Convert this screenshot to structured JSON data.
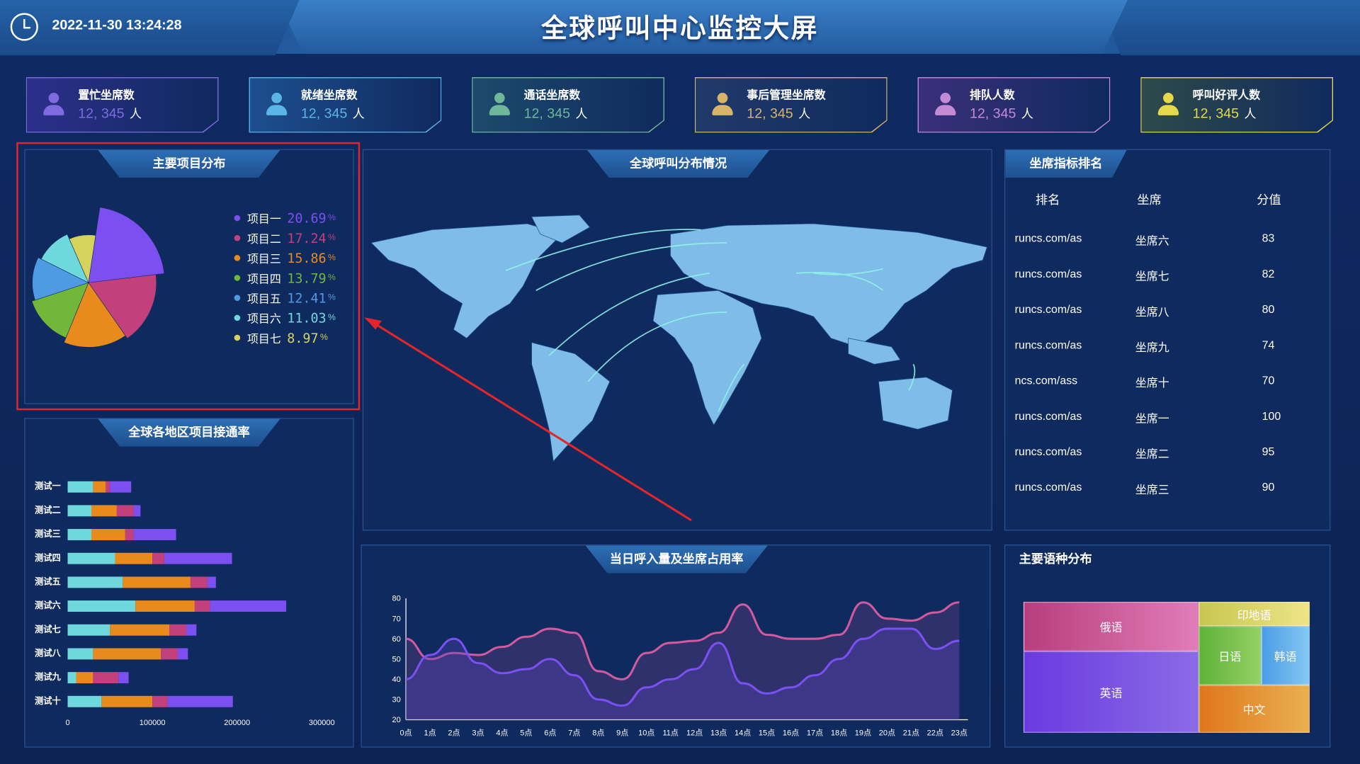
{
  "header": {
    "datetime": "2022-11-30 13:24:28",
    "title": "全球呼叫中心监控大屏"
  },
  "stats": [
    {
      "label": "置忙坐席数",
      "value": "12, 345",
      "unit": "人",
      "color": "#7e6be0",
      "bg": "#2c2f8a"
    },
    {
      "label": "就绪坐席数",
      "value": "12, 345",
      "unit": "人",
      "color": "#5bb5e6",
      "bg": "#1d4f8f"
    },
    {
      "label": "通话坐席数",
      "value": "12, 345",
      "unit": "人",
      "color": "#6fb69b",
      "bg": "#1c4a6c"
    },
    {
      "label": "事后管理坐席数",
      "value": "12, 345",
      "unit": "人",
      "color": "#d6b46a",
      "bg": "#203a6a"
    },
    {
      "label": "排队人数",
      "value": "12, 345",
      "unit": "人",
      "color": "#c48ad6",
      "bg": "#3a2f7a"
    },
    {
      "label": "呼叫好评人数",
      "value": "12, 345",
      "unit": "人",
      "color": "#e3d94a",
      "bg": "#2e4a4a"
    }
  ],
  "panels": {
    "pie": {
      "title": "主要项目分布",
      "items": [
        {
          "name": "项目一",
          "pct": "20.69",
          "sign": "%",
          "color": "#7b4ff0"
        },
        {
          "name": "项目二",
          "pct": "17.24",
          "sign": "%",
          "color": "#c2417d"
        },
        {
          "name": "项目三",
          "pct": "15.86",
          "sign": "%",
          "color": "#e98a1d"
        },
        {
          "name": "项目四",
          "pct": "13.79",
          "sign": "%",
          "color": "#72b63a"
        },
        {
          "name": "项目五",
          "pct": "12.41",
          "sign": "%",
          "color": "#4f9be3"
        },
        {
          "name": "项目六",
          "pct": "11.03",
          "sign": "%",
          "color": "#6fd8dc"
        },
        {
          "name": "项目七",
          "pct": "8.97",
          "sign": "%",
          "color": "#d6d35c"
        }
      ]
    },
    "map": {
      "title": "全球呼叫分布情况"
    },
    "rank": {
      "title": "坐席指标排名",
      "headers": [
        "排名",
        "坐席",
        "分值"
      ],
      "rows": [
        [
          "runcs.com/as",
          "坐席六",
          "83"
        ],
        [
          "runcs.com/as",
          "坐席七",
          "82"
        ],
        [
          "runcs.com/as",
          "坐席八",
          "80"
        ],
        [
          "runcs.com/as",
          "坐席九",
          "74"
        ],
        [
          "ncs.com/ass",
          "坐席十",
          "70"
        ],
        [
          "runcs.com/as",
          "坐席一",
          "100"
        ],
        [
          "runcs.com/as",
          "坐席二",
          "95"
        ],
        [
          "runcs.com/as",
          "坐席三",
          "90"
        ]
      ]
    },
    "bar": {
      "title": "全球各地区项目接通率"
    },
    "line": {
      "title": "当日呼入量及坐席占用率"
    },
    "tree": {
      "title": "主要语种分布",
      "items": [
        "俄语",
        "英语",
        "印地语",
        "日语",
        "韩语",
        "中文"
      ]
    }
  },
  "chart_data": [
    {
      "type": "pie",
      "categories": [
        "项目一",
        "项目二",
        "项目三",
        "项目四",
        "项目五",
        "项目六",
        "项目七"
      ],
      "values": [
        20.69,
        17.24,
        15.86,
        13.79,
        12.41,
        11.03,
        8.97
      ]
    },
    {
      "type": "bar",
      "categories": [
        "测试一",
        "测试二",
        "测试三",
        "测试四",
        "测试五",
        "测试六",
        "测试七",
        "测试八",
        "测试九",
        "测试十"
      ],
      "series": [
        {
          "values": [
            30000,
            28000,
            28000,
            56000,
            65000,
            80000,
            50000,
            30000,
            10000,
            40000
          ]
        },
        {
          "values": [
            15000,
            30000,
            40000,
            44000,
            80000,
            70000,
            70000,
            80000,
            20000,
            60000
          ]
        },
        {
          "values": [
            5000,
            20000,
            10000,
            14000,
            20000,
            18000,
            20000,
            20000,
            30000,
            18000
          ]
        },
        {
          "values": [
            25000,
            8000,
            50000,
            80000,
            10000,
            90000,
            12000,
            12000,
            12000,
            77000
          ]
        }
      ],
      "xlim": [
        0,
        300000
      ],
      "xticks": [
        "0",
        "100000",
        "200000",
        "300000"
      ]
    },
    {
      "type": "line",
      "x": [
        "0点",
        "1点",
        "2点",
        "3点",
        "4点",
        "5点",
        "6点",
        "7点",
        "8点",
        "9点",
        "10点",
        "11点",
        "12点",
        "13点",
        "14点",
        "15点",
        "16点",
        "17点",
        "18点",
        "19点",
        "20点",
        "21点",
        "22点",
        "23点"
      ],
      "series": [
        {
          "values": [
            60,
            50,
            53,
            52,
            56,
            61,
            65,
            63,
            44,
            40,
            53,
            58,
            59,
            63,
            77,
            62,
            60,
            60,
            62,
            78,
            70,
            69,
            73,
            78
          ]
        },
        {
          "values": [
            40,
            52,
            60,
            48,
            43,
            45,
            50,
            42,
            30,
            27,
            36,
            40,
            45,
            58,
            38,
            33,
            36,
            42,
            50,
            60,
            65,
            65,
            55,
            59
          ]
        }
      ],
      "ylim": [
        20,
        80
      ],
      "yticks": [
        "20",
        "30",
        "40",
        "50",
        "60",
        "70",
        "80"
      ]
    }
  ]
}
